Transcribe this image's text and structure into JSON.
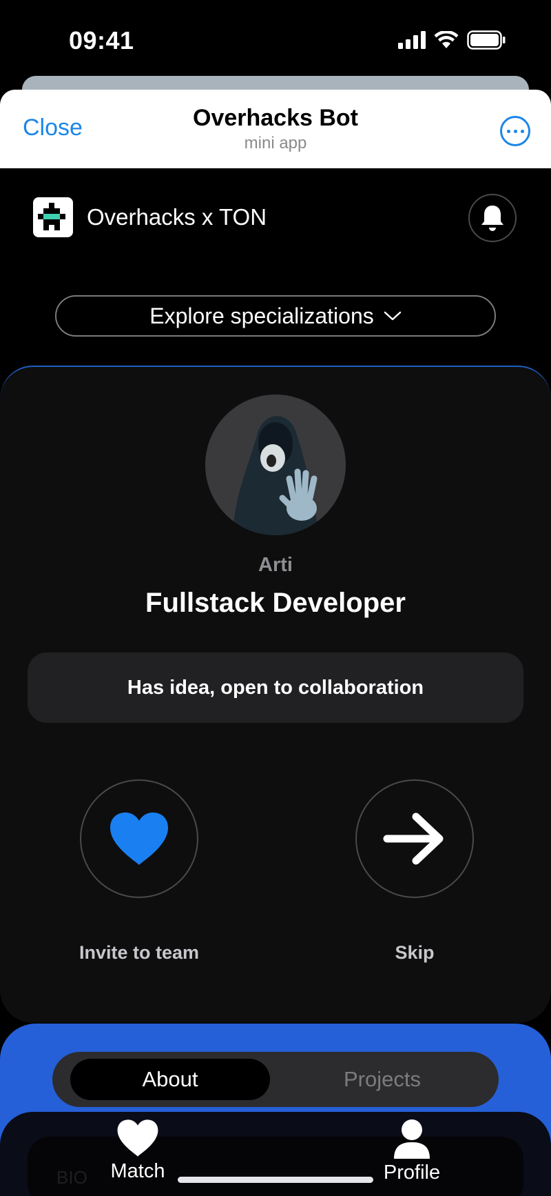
{
  "status_bar": {
    "time": "09:41"
  },
  "header": {
    "close_label": "Close",
    "title": "Overhacks Bot",
    "subtitle": "mini app"
  },
  "app": {
    "title": "Overhacks x TON"
  },
  "explore": {
    "label": "Explore specializations"
  },
  "profile_card": {
    "name": "Arti",
    "role": "Fullstack Developer",
    "status": "Has idea, open to collaboration",
    "invite_label": "Invite to team",
    "skip_label": "Skip"
  },
  "tabs": {
    "about": "About",
    "projects": "Projects",
    "active": "About"
  },
  "bio": {
    "label": "BIO"
  },
  "bottom_nav": {
    "match": "Match",
    "profile": "Profile"
  },
  "colors": {
    "accent": "#1a86e8",
    "heart": "#1a7ff0",
    "panel_blue": "#2560d8"
  }
}
